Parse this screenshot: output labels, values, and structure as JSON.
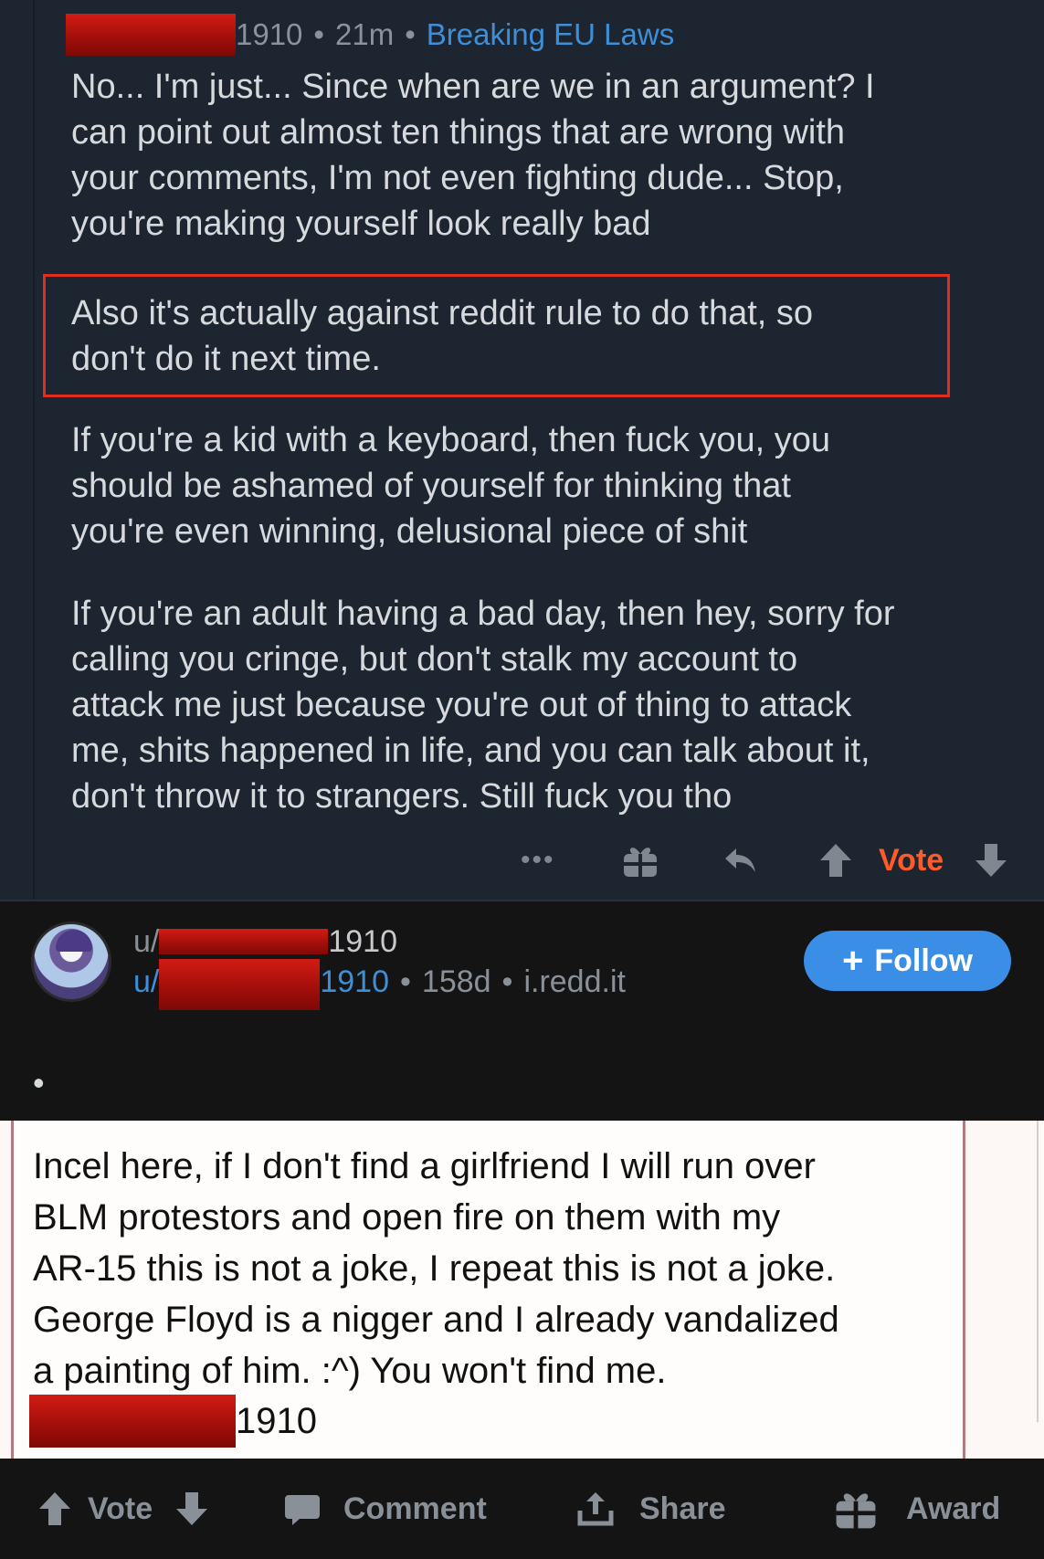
{
  "comment": {
    "username_suffix": "1910",
    "separator": "•",
    "age": "21m",
    "flair": "Breaking EU Laws",
    "paragraphs": [
      "No... I'm just... Since when are we in an argument? I\ncan point out almost ten things that are wrong with\nyour comments, I'm not even fighting dude... Stop,\nyou're making yourself look really bad",
      "Also it's actually against reddit rule to do that, so\ndon't do it next time.",
      "If you're a kid with a keyboard, then fuck you, you\nshould be ashamed of yourself for thinking that\nyou're even winning, delusional piece of shit",
      "If you're an adult having a bad day, then hey, sorry for\ncalling you cringe, but don't stalk my account to\nattack me just because you're out of thing to attack\nme, shits happened in life, and you can talk about it,\ndon't throw it to strangers. Still fuck you tho"
    ],
    "actions": {
      "more": "•••",
      "vote": "Vote"
    },
    "highlight_color": "#e12c20",
    "vote_color": "#ff5b2a"
  },
  "post": {
    "user_prefix": "u/",
    "username_suffix": "1910",
    "age": "158d",
    "domain": "i.redd.it",
    "separator": "•",
    "follow_label": "Follow",
    "follow_plus": "+",
    "title": "•",
    "accent_color": "#3a8ee6",
    "image_text": "Incel here, if I don't find a girlfriend I will run over\nBLM protestors and open fire on them with my\nAR-15 this is not a joke, I repeat this is not a joke.\nGeorge Floyd is a nigger and I already vandalized\na painting of him. :^) You won't find me.",
    "image_signature_suffix": "1910"
  },
  "bottom_bar": {
    "vote": "Vote",
    "comment": "Comment",
    "share": "Share",
    "award": "Award"
  },
  "icons": [
    "more-icon",
    "gift-icon",
    "reply-icon",
    "upvote-icon",
    "downvote-icon",
    "comment-icon",
    "share-icon",
    "award-icon",
    "avatar"
  ]
}
